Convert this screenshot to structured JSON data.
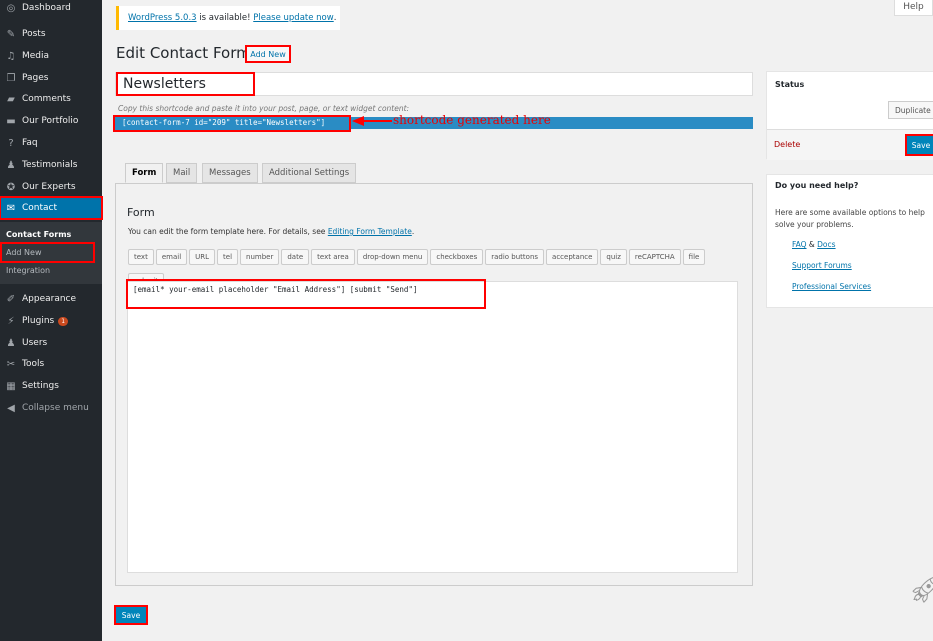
{
  "sidebar": {
    "items": [
      {
        "label": "Dashboard",
        "icon": "dashboard-icon",
        "glyph": "◎"
      },
      {
        "label": "Posts",
        "icon": "pin-icon",
        "glyph": "✎"
      },
      {
        "label": "Media",
        "icon": "media-icon",
        "glyph": "♫"
      },
      {
        "label": "Pages",
        "icon": "pages-icon",
        "glyph": "❐"
      },
      {
        "label": "Comments",
        "icon": "comments-icon",
        "glyph": "▰"
      },
      {
        "label": "Our Portfolio",
        "icon": "folder-icon",
        "glyph": "▬"
      },
      {
        "label": "Faq",
        "icon": "question-icon",
        "glyph": "?"
      },
      {
        "label": "Testimonials",
        "icon": "users-icon",
        "glyph": "♟"
      },
      {
        "label": "Our Experts",
        "icon": "award-icon",
        "glyph": "✪"
      },
      {
        "label": "Contact",
        "icon": "mail-icon",
        "glyph": "✉"
      },
      {
        "label": "Appearance",
        "icon": "brush-icon",
        "glyph": "✐"
      },
      {
        "label": "Plugins",
        "icon": "plugin-icon",
        "glyph": "⚡",
        "badge": "1"
      },
      {
        "label": "Users",
        "icon": "user-icon",
        "glyph": "♟"
      },
      {
        "label": "Tools",
        "icon": "wrench-icon",
        "glyph": "✂"
      },
      {
        "label": "Settings",
        "icon": "settings-icon",
        "glyph": "▦"
      },
      {
        "label": "Collapse menu",
        "icon": "collapse-icon",
        "glyph": "◀"
      }
    ],
    "submenu": [
      "Contact Forms",
      "Add New",
      "Integration"
    ]
  },
  "help_tab": "Help",
  "notice": {
    "link1": "WordPress 5.0.3",
    "text": " is available! ",
    "link2": "Please update now",
    "end": "."
  },
  "page_title": "Edit Contact Form",
  "add_new": "Add New",
  "title_value": "Newsletters",
  "shortcode_hint": "Copy this shortcode and paste it into your post, page, or text widget content:",
  "shortcode": "[contact-form-7 id=\"209\" title=\"Newsletters\"]",
  "annotation": "shortcode generated here",
  "tabs": [
    "Form",
    "Mail",
    "Messages",
    "Additional Settings"
  ],
  "form": {
    "heading": "Form",
    "desc": "You can edit the form template here. For details, see ",
    "desc_link": "Editing Form Template",
    "desc_end": ".",
    "tags": [
      "text",
      "email",
      "URL",
      "tel",
      "number",
      "date",
      "text area",
      "drop-down menu",
      "checkboxes",
      "radio buttons",
      "acceptance",
      "quiz",
      "reCAPTCHA",
      "file",
      "submit"
    ],
    "template": "[email* your-email placeholder \"Email Address\"] [submit \"Send\"]"
  },
  "status": {
    "title": "Status",
    "duplicate": "Duplicate",
    "delete": "Delete",
    "save": "Save"
  },
  "help": {
    "title": "Do you need help?",
    "text": "Here are some available options to help solve your problems.",
    "faq": "FAQ",
    "amp": " & ",
    "docs": "Docs",
    "forums": "Support Forums",
    "services": "Professional Services"
  },
  "save_bottom": "Save",
  "colors": {
    "sidebar": "#23282d",
    "accent": "#0073aa",
    "highlight": "#ff0000"
  }
}
